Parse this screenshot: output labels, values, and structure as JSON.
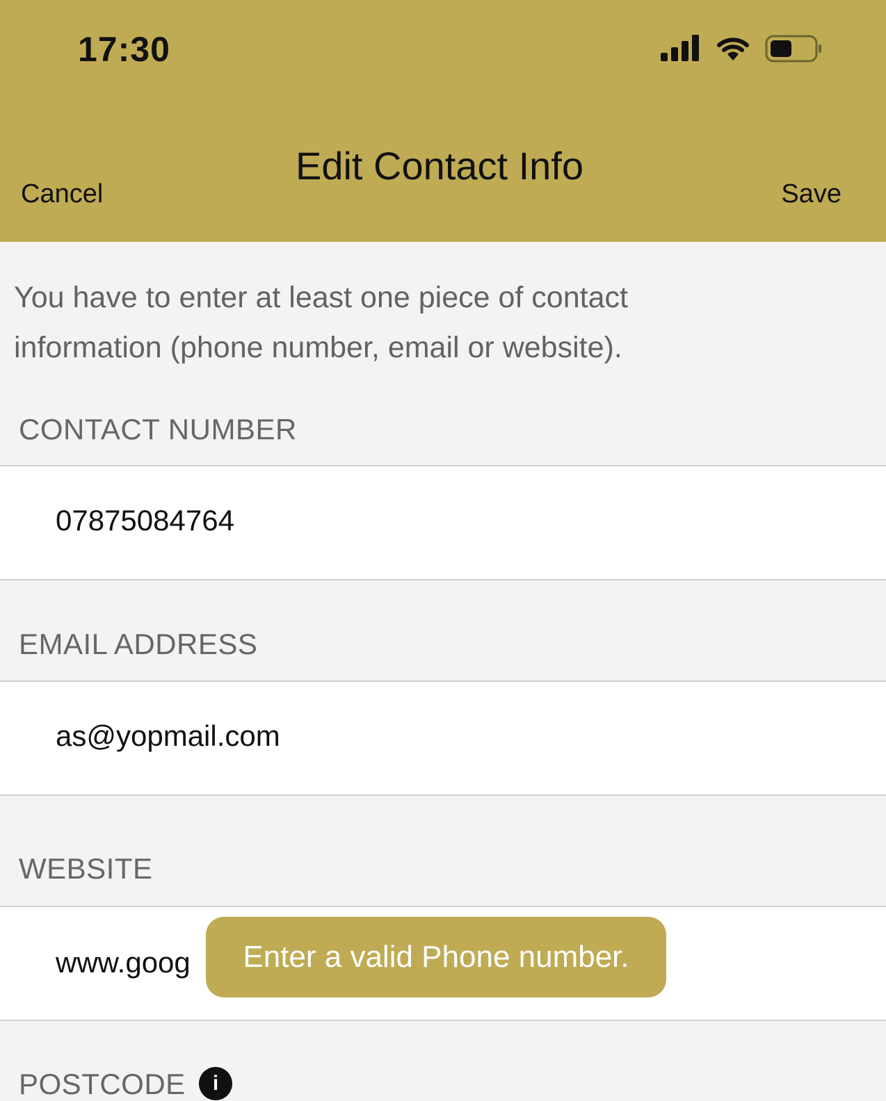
{
  "status_bar": {
    "time": "17:30"
  },
  "header": {
    "title": "Edit Contact Info",
    "cancel_label": "Cancel",
    "save_label": "Save"
  },
  "hint": "You have to enter at least one piece of contact information (phone number, email or website).",
  "sections": {
    "contact_number": {
      "label": "CONTACT NUMBER",
      "value": "07875084764"
    },
    "email": {
      "label": "EMAIL ADDRESS",
      "value": "as@yopmail.com"
    },
    "website": {
      "label": "WEBSITE",
      "value": "www.goog"
    },
    "postcode": {
      "label": "POSTCODE"
    }
  },
  "toast": {
    "message": "Enter a valid Phone number."
  },
  "colors": {
    "accent": "#bfab53",
    "background": "#f3f3f3",
    "field": "#ffffff",
    "label": "#666666"
  },
  "icons": [
    "signal-icon",
    "wifi-icon",
    "battery-icon",
    "info-icon"
  ]
}
